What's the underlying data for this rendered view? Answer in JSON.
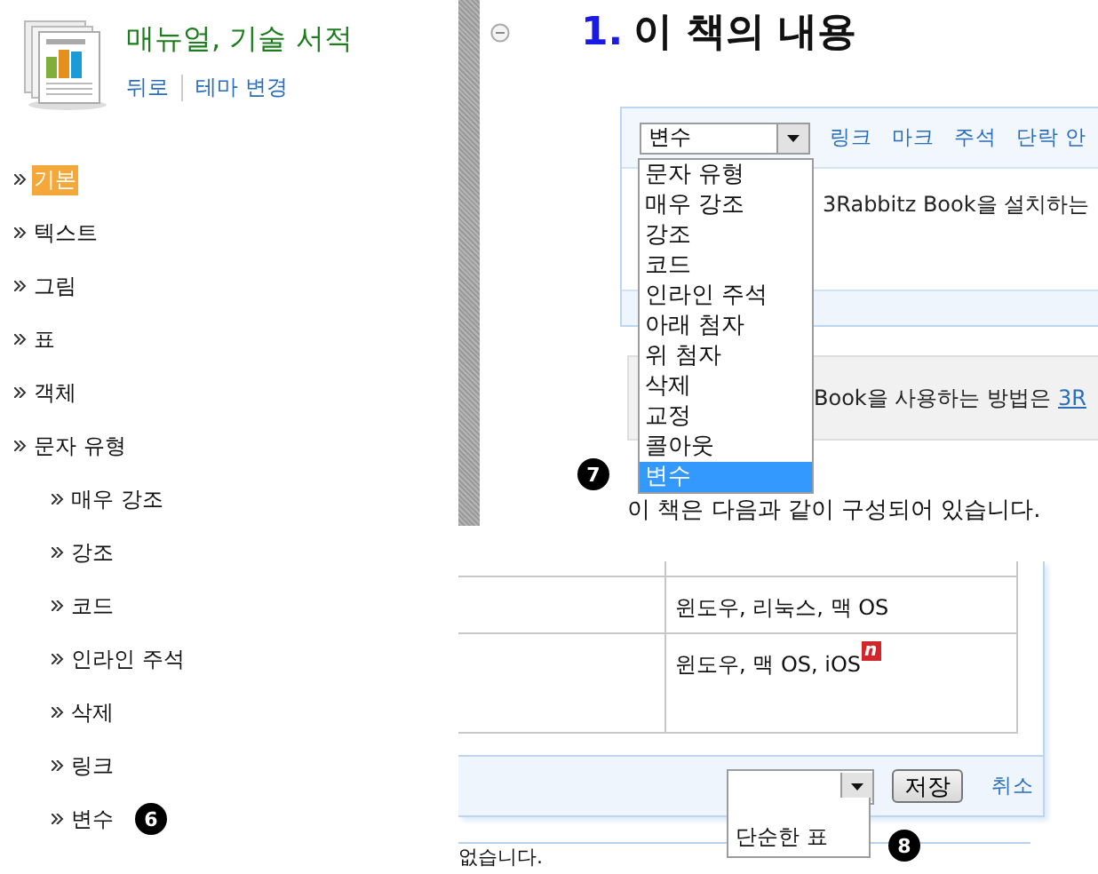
{
  "sidebar": {
    "title": "매뉴얼, 기술 서적",
    "links": [
      "뒤로",
      "테마 변경"
    ],
    "nav": [
      {
        "label": "기본",
        "selected": true
      },
      {
        "label": "텍스트",
        "selected": false
      },
      {
        "label": "그림",
        "selected": false
      },
      {
        "label": "표",
        "selected": false
      },
      {
        "label": "객체",
        "selected": false
      },
      {
        "label": "문자 유형",
        "selected": false,
        "children": [
          {
            "label": "매우 강조",
            "selected": false
          },
          {
            "label": "강조",
            "selected": false
          },
          {
            "label": "코드",
            "selected": false
          },
          {
            "label": "인라인 주석",
            "selected": false
          },
          {
            "label": "삭제",
            "selected": false
          },
          {
            "label": "링크",
            "selected": false
          },
          {
            "label": "변수",
            "selected": false,
            "callout": "6"
          }
        ]
      }
    ]
  },
  "top_view": {
    "heading_number": "1.",
    "heading": "이 책의 내용",
    "editor": {
      "select_value": "변수",
      "toolbar_links": [
        "링크",
        "마크",
        "주석",
        "단락 안"
      ],
      "body_text": "3Rabbitz Book을 설치하는",
      "dropdown": [
        {
          "label": "문자 유형",
          "selected": false
        },
        {
          "label": "매우 강조",
          "selected": false
        },
        {
          "label": "강조",
          "selected": false
        },
        {
          "label": "코드",
          "selected": false
        },
        {
          "label": "인라인 주석",
          "selected": false
        },
        {
          "label": "아래 첨자",
          "selected": false
        },
        {
          "label": "위 첨자",
          "selected": false
        },
        {
          "label": "삭제",
          "selected": false
        },
        {
          "label": "교정",
          "selected": false
        },
        {
          "label": "콜아웃",
          "selected": false
        },
        {
          "label": "변수",
          "selected": true
        }
      ]
    },
    "note_text": "Book을 사용하는 방법은",
    "note_link": "3R",
    "callout": "7",
    "paragraph": "이 책은 다음과 같이 구성되어 있습니다."
  },
  "bottom_view": {
    "table_rows": [
      {
        "kind": "partial"
      },
      {
        "column_2": "윈도우, 리눅스, 맥 OS"
      },
      {
        "column_2": "윈도우, 맥 OS, iOS",
        "new_badge": "n"
      }
    ],
    "footer": {
      "save_button": "저장",
      "cancel_link": "취소",
      "dropdown": [
        "단순한 표"
      ],
      "callout": "8"
    },
    "paragraph": "없습니다."
  }
}
